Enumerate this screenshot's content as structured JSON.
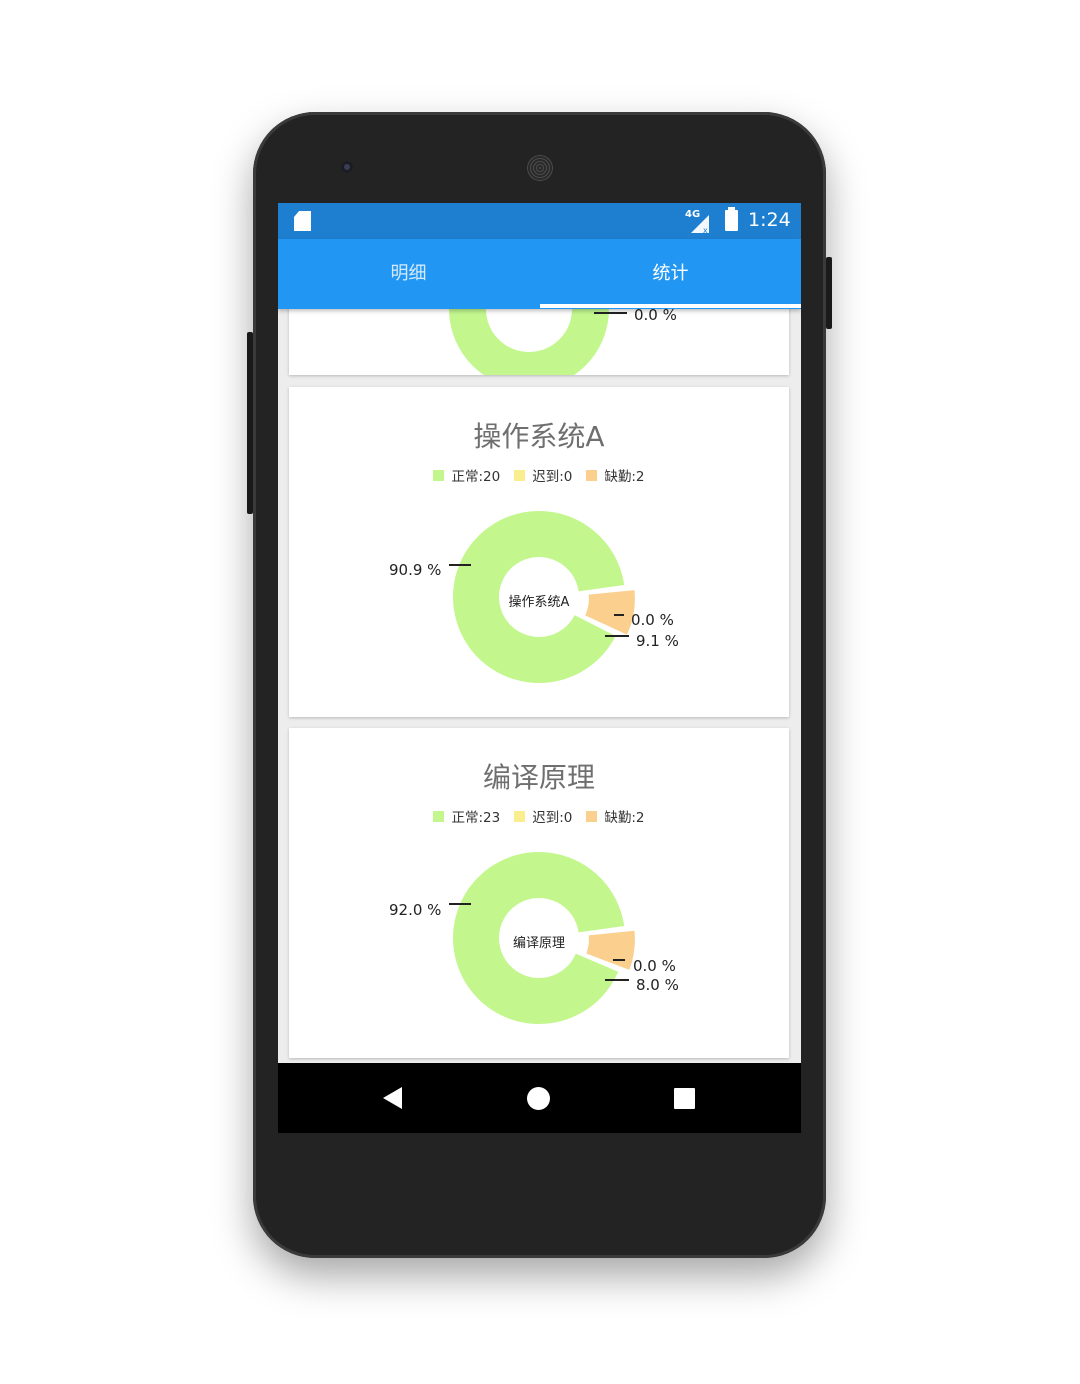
{
  "status_bar": {
    "time": "1:24",
    "network": "4G"
  },
  "tabs": [
    {
      "label": "明细",
      "active": false
    },
    {
      "label": "统计",
      "active": true
    }
  ],
  "colors": {
    "normal": "#c3f78e",
    "late": "#fbee8e",
    "absent": "#fbcf8e",
    "accent": "#2196f3"
  },
  "cards": [
    {
      "partial_label": "0.0 %"
    },
    {
      "title": "操作系统A",
      "legend": [
        "正常:20",
        "迟到:0",
        "缺勤:2"
      ],
      "center": "操作系统A",
      "labels": {
        "normal": "90.9 %",
        "late": "0.0 %",
        "absent": "9.1 %"
      }
    },
    {
      "title": "编译原理",
      "legend": [
        "正常:23",
        "迟到:0",
        "缺勤:2"
      ],
      "center": "编译原理",
      "labels": {
        "normal": "92.0 %",
        "late": "0.0 %",
        "absent": "8.0 %"
      }
    }
  ],
  "chart_data": [
    {
      "type": "pie",
      "title": "操作系统A",
      "categories": [
        "正常",
        "迟到",
        "缺勤"
      ],
      "values": [
        20,
        0,
        2
      ],
      "percent_labels": [
        90.9,
        0.0,
        9.1
      ],
      "legend": "top"
    },
    {
      "type": "pie",
      "title": "编译原理",
      "categories": [
        "正常",
        "迟到",
        "缺勤"
      ],
      "values": [
        23,
        0,
        2
      ],
      "percent_labels": [
        92.0,
        0.0,
        8.0
      ],
      "legend": "top"
    }
  ]
}
